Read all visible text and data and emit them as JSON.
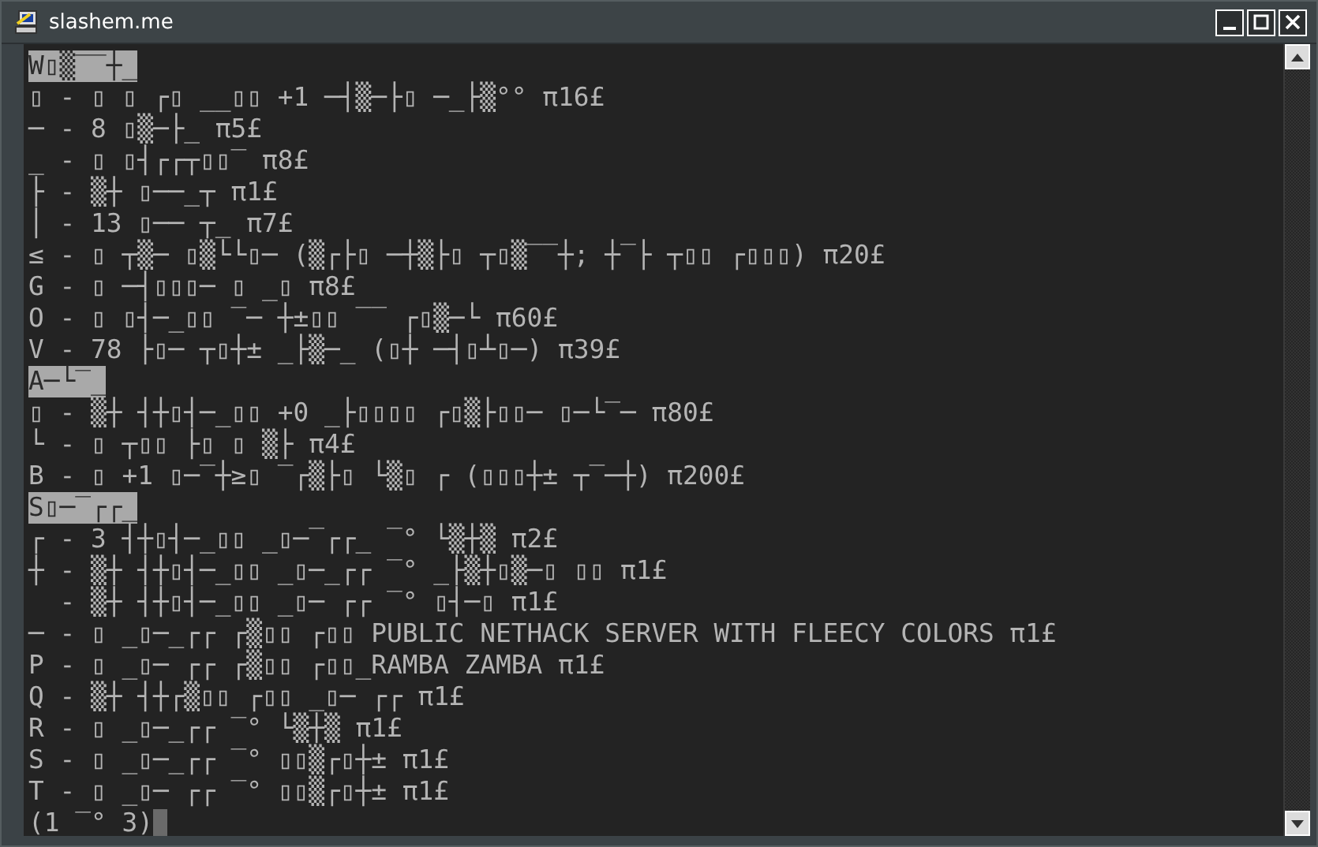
{
  "window": {
    "title": "slashem.me"
  },
  "lines": [
    {
      "kind": "header",
      "text": "W▯▒‾‾┼_"
    },
    {
      "kind": "item",
      "text": "▯ - ▯ ▯ ┌▯ __▯▯ +1 ─┤▒─├▯ ─_├▒°° π16£"
    },
    {
      "kind": "item",
      "text": "─ - 8 ▯▒─├_ π5£"
    },
    {
      "kind": "item",
      "text": "_ - ▯ ▯┤┌┌┬▯▯‾ π8£"
    },
    {
      "kind": "item",
      "text": "├ - ▒┼ ▯──_┬ π1£"
    },
    {
      "kind": "item",
      "text": "│ - 13 ▯── ┬_ π7£"
    },
    {
      "kind": "item",
      "text": "≤ - ▯ ┬▒─ ▯▒└└▯─ (▒┌├▯ ─┼▒├▯ ┬▯▒‾‾┼; ┼‾├ ┬▯▯ ┌▯▯▯) π20£"
    },
    {
      "kind": "item",
      "text": "G - ▯ ─┤▯▯▯─ ▯ _▯ π8£"
    },
    {
      "kind": "item",
      "text": "O - ▯ ▯┤─_▯▯ ‾─ ┼±▯▯ ‾‾ ┌▯▒─└ π60£"
    },
    {
      "kind": "item",
      "text": "V - 78 ├▯─ ┬▯┼± _├▒─_ (▯┼ ─┤▯┴▯─) π39£"
    },
    {
      "kind": "header",
      "text": "A─└‾_"
    },
    {
      "kind": "item",
      "text": "▯ - ▒┼ ┤┼▯┤─_▯▯ +0 _├▯▯▯▯ ┌▯▒├▯▯─ ▯─└‾─ π80£"
    },
    {
      "kind": "item",
      "text": "└ - ▯ ┬▯▯ ├▯ ▯ ▒├ π4£"
    },
    {
      "kind": "item",
      "text": "B - ▯ +1 ▯─‾┼≥▯ ‾┌▒├▯ └▒▯ ┌ (▯▯▯┼± ┬‾─┼) π200£"
    },
    {
      "kind": "header",
      "text": "S▯─‾┌┌_"
    },
    {
      "kind": "item",
      "text": "┌ - 3 ┤┼▯┤─_▯▯ _▯─‾┌┌_ ‾° └▒┼▒ π2£"
    },
    {
      "kind": "item",
      "text": "┼ - ▒┼ ┤┼▯┤─_▯▯ _▯─_┌┌ ‾° _├▒┼▯▒─▯ ▯▯ π1£"
    },
    {
      "kind": "item",
      "text": "  - ▒┼ ┤┼▯┤─_▯▯ _▯─ ┌┌ ‾° ▯┤─▯ π1£"
    },
    {
      "kind": "item",
      "text": "─ - ▯ _▯─_┌┌ ┌▒▯▯ ┌▯▯ PUBLIC NETHACK SERVER WITH FLEECY COLORS π1£"
    },
    {
      "kind": "item",
      "text": "P - ▯ _▯─ ┌┌ ┌▒▯▯ ┌▯▯_RAMBA ZAMBA π1£"
    },
    {
      "kind": "item",
      "text": "Q - ▒┼ ┤┼┌▒▯▯ ┌▯▯ _▯─ ┌┌ π1£"
    },
    {
      "kind": "item",
      "text": "R - ▯ _▯─_┌┌ ‾° └▒┼▒ π1£"
    },
    {
      "kind": "item",
      "text": "S - ▯ _▯─_┌┌ ‾° ▯▯▒┌▯┼± π1£"
    },
    {
      "kind": "item",
      "text": "T - ▯ _▯─ ┌┌ ‾° ▯▯▒┌▯┼± π1£"
    },
    {
      "kind": "prompt",
      "text": "(1 ‾° 3)"
    }
  ]
}
